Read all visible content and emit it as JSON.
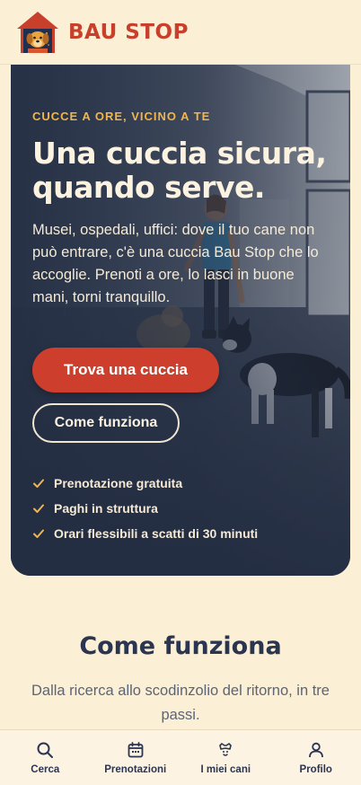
{
  "header": {
    "brand": "BAU STOP",
    "logo_icon": "dog-house-logo-icon"
  },
  "hero": {
    "eyebrow": "CUCCE A ORE, VICINO A TE",
    "title": "Una cuccia sicura, quando serve.",
    "text": "Musei, ospedali, uffici: dove il tuo cane non può entrare, c'è una cuccia Bau Stop che lo accoglie. Prenoti a ore, lo lasci in buone mani, torni tranquillo.",
    "primary_cta": "Trova una cuccia",
    "secondary_cta": "Come funziona",
    "features": [
      "Prenotazione gratuita",
      "Paghi in struttura",
      "Orari flessibili a scatti di 30 minuti"
    ],
    "accent_color": "#f2b54a"
  },
  "how": {
    "title": "Come funziona",
    "subtitle": "Dalla ricerca allo scodinzolio del ritorno, in tre passi."
  },
  "nav": {
    "items": [
      {
        "label": "Cerca",
        "icon": "search-icon"
      },
      {
        "label": "Prenotazioni",
        "icon": "calendar-icon"
      },
      {
        "label": "I miei cani",
        "icon": "paw-icon"
      },
      {
        "label": "Profilo",
        "icon": "user-icon"
      }
    ]
  },
  "colors": {
    "brand": "#c8402b",
    "background": "#fbefd6",
    "hero_dark": "#2e3a4f",
    "primary_button": "#cd3f2c"
  }
}
